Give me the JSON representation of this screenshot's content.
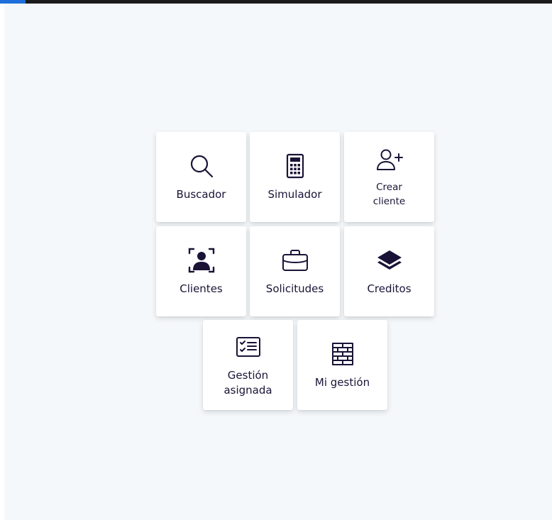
{
  "colors": {
    "topbar": "#1b1b1b",
    "accent": "#1e6fd9",
    "background": "#f5f8fa",
    "tile": "#ffffff",
    "icon": "#1a1336"
  },
  "menu": {
    "tiles": [
      {
        "label": "Buscador",
        "icon": "search-icon"
      },
      {
        "label": "Simulador",
        "icon": "calculator-icon"
      },
      {
        "label": "Crear\ncliente",
        "icon": "user-plus-icon"
      },
      {
        "label": "Clientes",
        "icon": "user-focus-icon"
      },
      {
        "label": "Solicitudes",
        "icon": "briefcase-icon"
      },
      {
        "label": "Creditos",
        "icon": "layers-icon"
      },
      {
        "label": "Gestión\nasignada",
        "icon": "checklist-icon"
      },
      {
        "label": "Mi gestión",
        "icon": "brick-wall-icon"
      }
    ]
  }
}
